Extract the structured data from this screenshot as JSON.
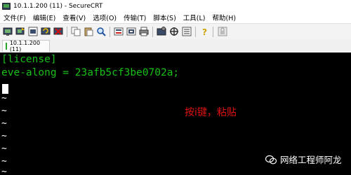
{
  "window": {
    "title": "10.1.1.200 (11) - SecureCRT"
  },
  "menu": {
    "items": [
      "文件(F)",
      "编辑(E)",
      "查看(V)",
      "选项(O)",
      "传输(T)",
      "脚本(S)",
      "工具(L)",
      "帮助(H)"
    ]
  },
  "toolbar": {
    "icons": [
      "connect-icon",
      "quick-connect-icon",
      "connect-in-tab-icon",
      "reconnect-icon",
      "disconnect-icon",
      "copy-icon",
      "paste-icon",
      "find-icon",
      "session-options-icon",
      "global-options-icon",
      "print-icon",
      "properties-icon",
      "sftp-icon",
      "keymap-icon",
      "help-icon",
      "lock-icon"
    ]
  },
  "tabs": [
    {
      "label": "10.1.1.200 (11)",
      "status_color": "#2aa52a"
    }
  ],
  "terminal": {
    "lines": [
      "[license]",
      "eve-along = 23afb5cf3be0702a;"
    ],
    "tilde": "~",
    "text_color": "#18c018",
    "background": "#000000"
  },
  "annotation": {
    "text": "按i键，粘贴",
    "color": "#e01010"
  },
  "watermark": {
    "text": "网络工程师阿龙"
  }
}
